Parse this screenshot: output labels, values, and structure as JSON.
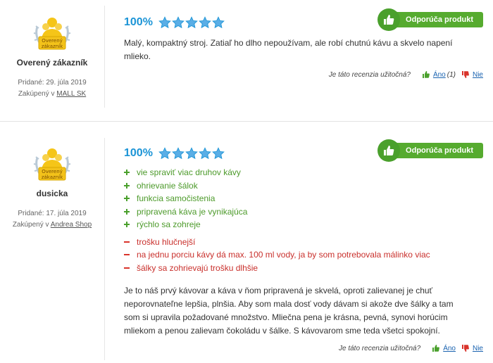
{
  "colors": {
    "accent_blue": "#1b94d6",
    "recommend_green": "#56ab2f",
    "pro_green": "#4c9a2a",
    "con_red": "#c9302c",
    "badge_gold": "#f5c518"
  },
  "reviews": [
    {
      "badge_icon": "verified-customer-badge-icon",
      "badge_text_line1": "Overený",
      "badge_text_line2": "zákazník",
      "author": "Overený zákazník",
      "added": "Pridané: 29. júla 2019",
      "bought_prefix": "Zakúpený v",
      "bought_store": "MALL SK",
      "rating_percent": "100%",
      "stars": 5,
      "recommend_label": "Odporúča produkt",
      "text": "Malý, kompaktný stroj. Zatiaľ ho dlho nepoužívam, ale robí chutnú kávu a skvelo napení mlieko.",
      "pros": [],
      "cons": [],
      "helpful_question": "Je táto recenzia užitočná?",
      "yes_label": "Áno",
      "yes_count": "(1)",
      "no_label": "Nie"
    },
    {
      "badge_icon": "verified-customer-badge-icon",
      "badge_text_line1": "Overený",
      "badge_text_line2": "zákazník",
      "author": "dusicka",
      "added": "Pridané: 17. júla 2019",
      "bought_prefix": "Zakúpený v",
      "bought_store": "Andrea Shop",
      "rating_percent": "100%",
      "stars": 5,
      "recommend_label": "Odporúča produkt",
      "pros": [
        "vie spraviť viac druhov kávy",
        "ohrievanie šálok",
        "funkcia samočistenia",
        "pripravená káva je vynikajúca",
        "rýchlo sa zohreje"
      ],
      "cons": [
        "trošku hlučnejší",
        "na jednu porciu kávy dá max. 100 ml vody, ja by som potrebovala málinko viac",
        "šálky sa zohrievajú trošku dlhšie"
      ],
      "text": "Je to náš prvý kávovar a káva v ňom pripravená je skvelá, oproti zalievanej je chuť neporovnateľne lepšia, plnšia. Aby som mala dosť vody dávam si akože dve šálky a tam som si upravila požadované množstvo. Mliečna pena je krásna, pevná, synovi horúcim mliekom a penou zalievam čokoládu v šálke. S kávovarom sme teda všetci spokojní.",
      "helpful_question": "Je táto recenzia užitočná?",
      "yes_label": "Áno",
      "no_label": "Nie"
    }
  ]
}
